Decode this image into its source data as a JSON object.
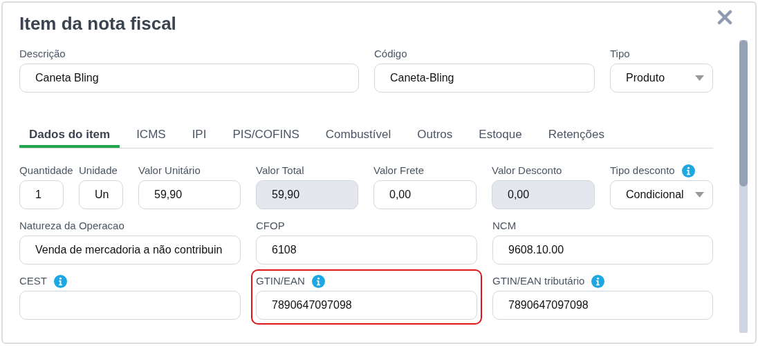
{
  "dialog": {
    "title": "Item da nota fiscal"
  },
  "header_fields": [
    {
      "label": "Descrição",
      "value": "Caneta Bling",
      "kind": "text",
      "disabled": false,
      "info": false,
      "highlighted": false
    },
    {
      "label": "Código",
      "value": "Caneta-Bling",
      "kind": "text",
      "disabled": false,
      "info": false,
      "highlighted": false
    },
    {
      "label": "Tipo",
      "value": "Produto",
      "kind": "select",
      "disabled": false,
      "info": false,
      "highlighted": false
    }
  ],
  "tabs": [
    {
      "label": "Dados do item",
      "selected": true
    },
    {
      "label": "ICMS",
      "selected": false
    },
    {
      "label": "IPI",
      "selected": false
    },
    {
      "label": "PIS/COFINS",
      "selected": false
    },
    {
      "label": "Combustível",
      "selected": false
    },
    {
      "label": "Outros",
      "selected": false
    },
    {
      "label": "Estoque",
      "selected": false
    },
    {
      "label": "Retenções",
      "selected": false
    }
  ],
  "field_rows": [
    [
      {
        "label": "Quantidade",
        "value": "1",
        "kind": "text",
        "disabled": false,
        "info": false,
        "highlighted": false
      },
      {
        "label": "Unidade",
        "value": "Un",
        "kind": "text",
        "disabled": false,
        "info": false,
        "highlighted": false
      },
      {
        "label": "Valor Unitário",
        "value": "59,90",
        "kind": "text",
        "disabled": false,
        "info": false,
        "highlighted": false
      },
      {
        "label": "Valor Total",
        "value": "59,90",
        "kind": "text",
        "disabled": true,
        "info": false,
        "highlighted": false
      },
      {
        "label": "Valor Frete",
        "value": "0,00",
        "kind": "text",
        "disabled": false,
        "info": false,
        "highlighted": false
      },
      {
        "label": "Valor Desconto",
        "value": "0,00",
        "kind": "text",
        "disabled": true,
        "info": false,
        "highlighted": false
      },
      {
        "label": "Tipo desconto",
        "value": "Condicional",
        "kind": "select",
        "disabled": false,
        "info": true,
        "highlighted": false
      }
    ],
    [
      {
        "label": "Natureza da Operacao",
        "value": "Venda de mercadoria a não contribuin",
        "kind": "text",
        "disabled": false,
        "info": false,
        "highlighted": false
      },
      {
        "label": "CFOP",
        "value": "6108",
        "kind": "text",
        "disabled": false,
        "info": false,
        "highlighted": false
      },
      {
        "label": "NCM",
        "value": "9608.10.00",
        "kind": "text",
        "disabled": false,
        "info": false,
        "highlighted": false
      }
    ],
    [
      {
        "label": "CEST",
        "kind": "text",
        "disabled": false,
        "info": true,
        "highlighted": false
      },
      {
        "label": "GTIN/EAN",
        "value": "7890647097098",
        "kind": "text",
        "disabled": false,
        "info": true,
        "highlighted": true
      },
      {
        "label": "GTIN/EAN tributário",
        "value": "7890647097098",
        "kind": "text",
        "disabled": false,
        "info": true,
        "highlighted": false
      }
    ]
  ]
}
